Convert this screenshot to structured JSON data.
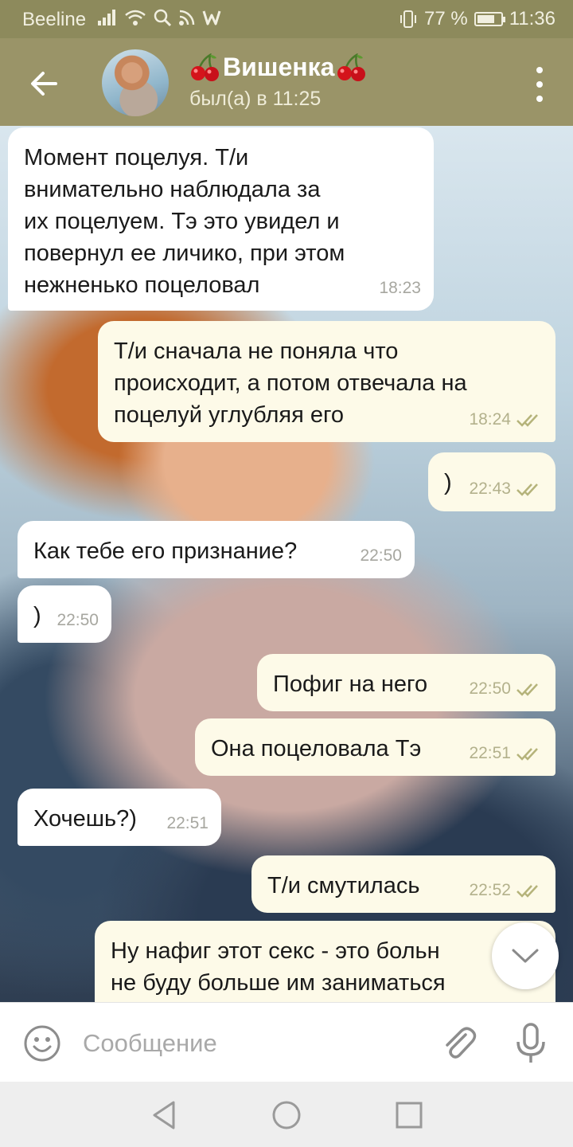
{
  "status": {
    "carrier": "Beeline",
    "battery_text": "77 %",
    "battery_level": 0.77,
    "time": "11:36"
  },
  "header": {
    "title": "Вишенка",
    "title_decoration_icon": "cherry-icon",
    "last_seen": "был(а) в 11:25",
    "back_icon": "back-arrow-icon",
    "menu_icon": "more-vertical-icon"
  },
  "messages": [
    {
      "dir": "in",
      "text": "Момент поцелуя. Т/и\nвнимательно наблюдала за\nих поцелуем. Тэ это увидел и\nповернул ее личико, при этом\nнежненько поцеловал",
      "time": "18:23"
    },
    {
      "dir": "out",
      "text": "Т/и сначала не поняла что\nпроисходит, а потом отвечала на\nпоцелуй углубляя его",
      "time": "18:24",
      "read": true
    },
    {
      "dir": "out",
      "text": ")",
      "time": "22:43",
      "read": true
    },
    {
      "dir": "in",
      "text": "Как тебе его признание?",
      "time": "22:50"
    },
    {
      "dir": "in",
      "text": ")",
      "time": "22:50"
    },
    {
      "dir": "out",
      "text": "Пофиг на него",
      "time": "22:50",
      "read": true
    },
    {
      "dir": "out",
      "text": "Она поцеловала Тэ",
      "time": "22:51",
      "read": true
    },
    {
      "dir": "in",
      "text": "Хочешь?)",
      "time": "22:51"
    },
    {
      "dir": "out",
      "text": "Т/и смутилась",
      "time": "22:52",
      "read": true
    },
    {
      "dir": "out",
      "text": "Ну нафиг этот секс - это больн\nне буду больше им заниматься",
      "time": "",
      "read": false
    }
  ],
  "composer": {
    "placeholder": "Сообщение",
    "emoji_icon": "emoji-icon",
    "attach_icon": "paperclip-icon",
    "mic_icon": "microphone-icon"
  },
  "colors": {
    "header_bg": "#9a9468",
    "status_bg": "#8d8a5c",
    "incoming_bubble": "#ffffff",
    "outgoing_bubble": "#fdfae8",
    "read_check": "#b5b37a"
  }
}
